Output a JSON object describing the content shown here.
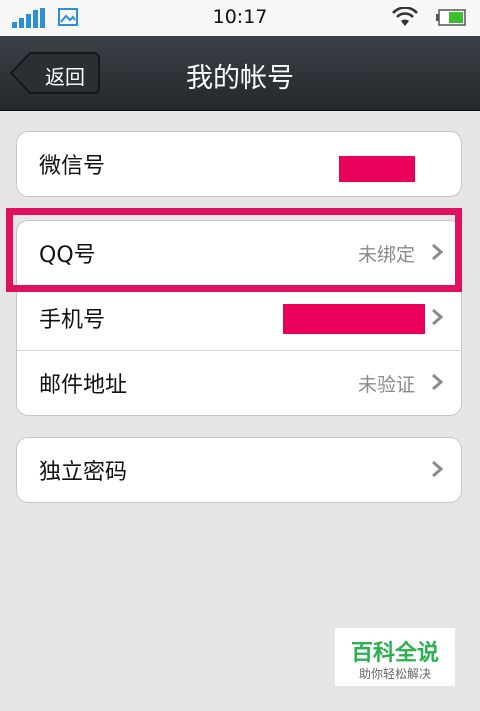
{
  "status_bar": {
    "time": "10:17"
  },
  "header": {
    "back_label": "返回",
    "title": "我的帐号"
  },
  "groups": [
    {
      "rows": [
        {
          "label": "微信号",
          "value": ""
        }
      ]
    },
    {
      "rows": [
        {
          "label": "QQ号",
          "value": "未绑定"
        },
        {
          "label": "手机号",
          "value": ""
        },
        {
          "label": "邮件地址",
          "value": "未验证"
        }
      ]
    },
    {
      "rows": [
        {
          "label": "独立密码",
          "value": ""
        }
      ]
    }
  ],
  "watermark": {
    "main": "百科全说",
    "sub": "助你轻松解决"
  },
  "colors": {
    "redaction": "#e8005a",
    "highlight": "#e0115f",
    "watermark": "#2ab04e"
  }
}
